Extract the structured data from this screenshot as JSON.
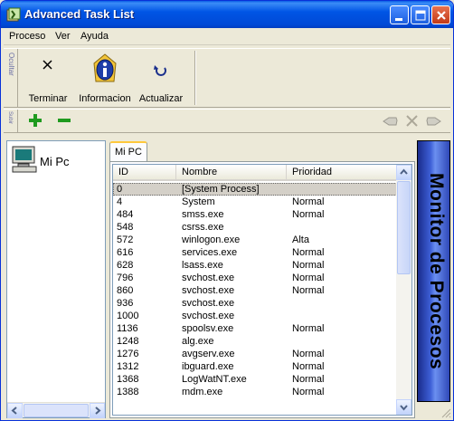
{
  "window": {
    "title": "Advanced Task List",
    "minimize_icon": "minimize-icon",
    "maximize_icon": "maximize-icon",
    "close_icon": "close-icon"
  },
  "menu": {
    "items": [
      "Proceso",
      "Ver",
      "Ayuda"
    ]
  },
  "toolbar_main": {
    "band_label": "Ocultar",
    "buttons": [
      {
        "label": "Terminar",
        "icon": "close-x-icon"
      },
      {
        "label": "Informacion",
        "icon": "info-icon"
      },
      {
        "label": "Actualizar",
        "icon": "refresh-icon"
      }
    ]
  },
  "toolbar_priority": {
    "band_label": "Subir",
    "buttons": [
      {
        "icon": "plus-icon",
        "color": "#1f9a1f"
      },
      {
        "icon": "minus-icon",
        "color": "#1f9a1f"
      }
    ],
    "right_buttons": [
      {
        "icon": "left-hand-icon"
      },
      {
        "icon": "disabled-x-icon"
      },
      {
        "icon": "right-hand-icon"
      }
    ]
  },
  "tree": {
    "root": {
      "label": "Mi Pc",
      "icon": "computer-icon"
    }
  },
  "tab": {
    "label": "Mi PC"
  },
  "table": {
    "columns": [
      "ID",
      "Nombre",
      "Prioridad"
    ],
    "rows": [
      {
        "id": "0",
        "name": "[System Process]",
        "priority": ""
      },
      {
        "id": "4",
        "name": "System",
        "priority": "Normal"
      },
      {
        "id": "484",
        "name": "smss.exe",
        "priority": "Normal"
      },
      {
        "id": "548",
        "name": "csrss.exe",
        "priority": ""
      },
      {
        "id": "572",
        "name": "winlogon.exe",
        "priority": "Alta"
      },
      {
        "id": "616",
        "name": "services.exe",
        "priority": "Normal"
      },
      {
        "id": "628",
        "name": "lsass.exe",
        "priority": "Normal"
      },
      {
        "id": "796",
        "name": "svchost.exe",
        "priority": "Normal"
      },
      {
        "id": "860",
        "name": "svchost.exe",
        "priority": "Normal"
      },
      {
        "id": "936",
        "name": "svchost.exe",
        "priority": ""
      },
      {
        "id": "1000",
        "name": "svchost.exe",
        "priority": ""
      },
      {
        "id": "1136",
        "name": "spoolsv.exe",
        "priority": "Normal"
      },
      {
        "id": "1248",
        "name": "alg.exe",
        "priority": ""
      },
      {
        "id": "1276",
        "name": "avgserv.exe",
        "priority": "Normal"
      },
      {
        "id": "1312",
        "name": "ibguard.exe",
        "priority": "Normal"
      },
      {
        "id": "1368",
        "name": "LogWatNT.exe",
        "priority": "Normal"
      },
      {
        "id": "1388",
        "name": "mdm.exe",
        "priority": "Normal"
      }
    ],
    "selected_index": 0
  },
  "banner": {
    "text": "Monitor de Procesos"
  },
  "colors": {
    "titlebar": "#0055e5",
    "selected_row": "#d4d0c8",
    "banner_blue": "#3d5fd6"
  }
}
